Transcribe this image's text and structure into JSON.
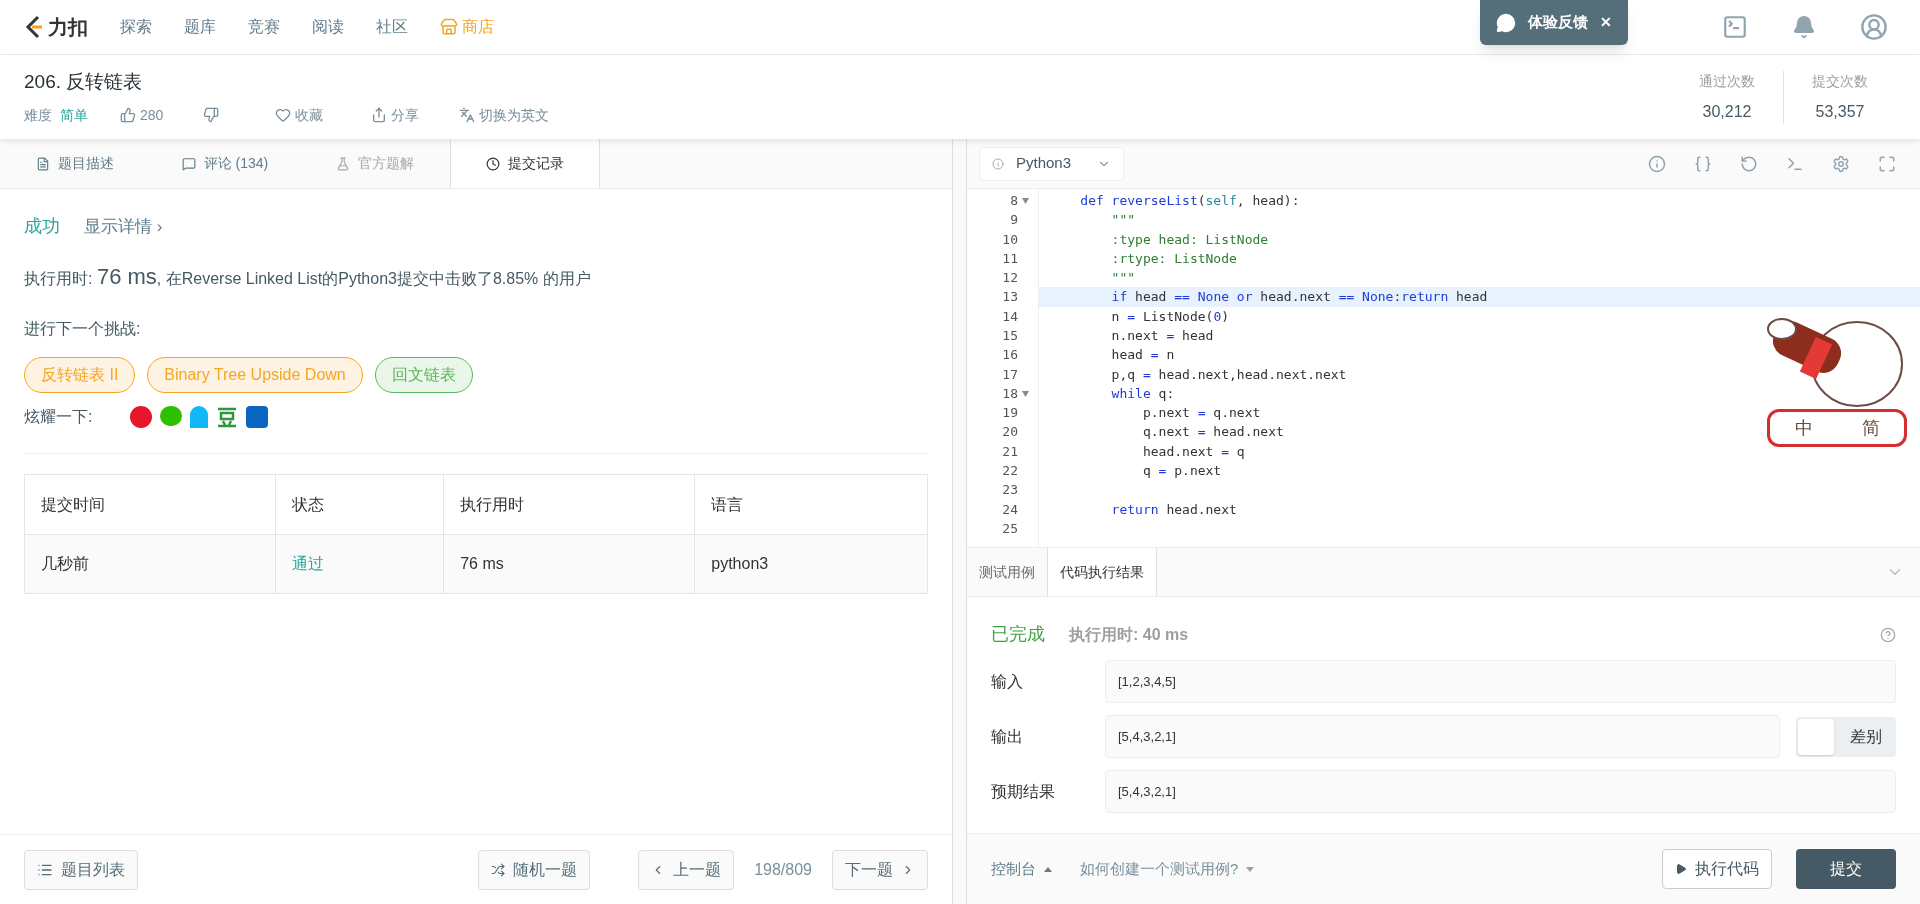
{
  "nav": {
    "logo": "力扣",
    "items": [
      {
        "label": "探索",
        "kind": "link"
      },
      {
        "label": "题库",
        "kind": "link"
      },
      {
        "label": "竞赛",
        "kind": "link"
      },
      {
        "label": "阅读",
        "kind": "link"
      },
      {
        "label": "社区",
        "kind": "link"
      },
      {
        "label": "商店",
        "kind": "store"
      }
    ]
  },
  "toast": {
    "label": "体验反馈",
    "close": "✕"
  },
  "problem": {
    "title": "206. 反转链表",
    "difficulty_label": "难度",
    "difficulty": "简单",
    "likes": "280",
    "favorite": "收藏",
    "share": "分享",
    "translate": "切换为英文"
  },
  "stats": [
    {
      "label": "通过次数",
      "value": "30,212"
    },
    {
      "label": "提交次数",
      "value": "53,357"
    }
  ],
  "tabs": [
    {
      "label": "题目描述",
      "selected": false,
      "disabled": false
    },
    {
      "label": "评论 (134)",
      "selected": false,
      "disabled": false
    },
    {
      "label": "官方题解",
      "selected": false,
      "disabled": true
    },
    {
      "label": "提交记录",
      "selected": true,
      "disabled": false
    }
  ],
  "result": {
    "status": "成功",
    "details": "显示详情 ›",
    "runtime_label": "执行用时: ",
    "runtime": "76 ms",
    "runtime_rest": ", 在Reverse Linked List的Python3提交中击败了8.85% 的用户",
    "next_label": "进行下一个挑战:",
    "challenges": [
      {
        "label": "反转链表 II",
        "color": "#f5a623"
      },
      {
        "label": "Binary Tree Upside Down",
        "color": "#f5a623"
      },
      {
        "label": "回文链表",
        "color": "#5cb85c"
      }
    ],
    "share_label": "炫耀一下:"
  },
  "submissions": {
    "columns": [
      "提交时间",
      "状态",
      "执行用时",
      "语言"
    ],
    "rows": [
      {
        "time": "几秒前",
        "status": "通过",
        "runtime": "76 ms",
        "language": "python3"
      }
    ]
  },
  "editor": {
    "language": "Python3",
    "lines": [
      {
        "number": "8",
        "foldable": true,
        "active": false,
        "tokens": [
          {
            "text": "    def reverseList",
            "kind": "keyword"
          },
          {
            "text": "(",
            "kind": "plain"
          },
          {
            "text": "self",
            "kind": "self"
          },
          {
            "text": ", head):",
            "kind": "plain"
          }
        ]
      },
      {
        "number": "9",
        "foldable": false,
        "active": false,
        "tokens": [
          {
            "text": "        \"\"\"",
            "kind": "docstring"
          }
        ]
      },
      {
        "number": "10",
        "foldable": false,
        "active": false,
        "tokens": [
          {
            "text": "        :type head: ListNode",
            "kind": "docstring"
          }
        ]
      },
      {
        "number": "11",
        "foldable": false,
        "active": false,
        "tokens": [
          {
            "text": "        :rtype: ListNode",
            "kind": "docstring"
          }
        ]
      },
      {
        "number": "12",
        "foldable": false,
        "active": false,
        "tokens": [
          {
            "text": "        \"\"\"",
            "kind": "docstring"
          }
        ]
      },
      {
        "number": "13",
        "foldable": false,
        "active": true,
        "tokens": [
          {
            "text": "        if",
            "kind": "keyword"
          },
          {
            "text": " head ",
            "kind": "plain"
          },
          {
            "text": "== None or",
            "kind": "keyword"
          },
          {
            "text": " head.next ",
            "kind": "plain"
          },
          {
            "text": "== None",
            "kind": "keyword"
          },
          {
            "text": ":",
            "kind": "plain"
          },
          {
            "text": "return",
            "kind": "keyword"
          },
          {
            "text": " head",
            "kind": "plain"
          }
        ]
      },
      {
        "number": "14",
        "foldable": false,
        "active": false,
        "tokens": [
          {
            "text": "        n ",
            "kind": "plain"
          },
          {
            "text": "=",
            "kind": "keyword"
          },
          {
            "text": " ListNode(",
            "kind": "plain"
          },
          {
            "text": "0",
            "kind": "number"
          },
          {
            "text": ")",
            "kind": "plain"
          }
        ]
      },
      {
        "number": "15",
        "foldable": false,
        "active": false,
        "tokens": [
          {
            "text": "        n.next ",
            "kind": "plain"
          },
          {
            "text": "=",
            "kind": "keyword"
          },
          {
            "text": " head",
            "kind": "plain"
          }
        ]
      },
      {
        "number": "16",
        "foldable": false,
        "active": false,
        "tokens": [
          {
            "text": "        head ",
            "kind": "plain"
          },
          {
            "text": "=",
            "kind": "keyword"
          },
          {
            "text": " n",
            "kind": "plain"
          }
        ]
      },
      {
        "number": "17",
        "foldable": false,
        "active": false,
        "tokens": [
          {
            "text": "        p,q ",
            "kind": "plain"
          },
          {
            "text": "=",
            "kind": "keyword"
          },
          {
            "text": " head.next,head.next.next",
            "kind": "plain"
          }
        ]
      },
      {
        "number": "18",
        "foldable": true,
        "active": false,
        "tokens": [
          {
            "text": "        while",
            "kind": "keyword"
          },
          {
            "text": " q:",
            "kind": "plain"
          }
        ]
      },
      {
        "number": "19",
        "foldable": false,
        "active": false,
        "tokens": [
          {
            "text": "            p.next ",
            "kind": "plain"
          },
          {
            "text": "=",
            "kind": "keyword"
          },
          {
            "text": " q.next",
            "kind": "plain"
          }
        ]
      },
      {
        "number": "20",
        "foldable": false,
        "active": false,
        "tokens": [
          {
            "text": "            q.next ",
            "kind": "plain"
          },
          {
            "text": "=",
            "kind": "keyword"
          },
          {
            "text": " head.next",
            "kind": "plain"
          }
        ]
      },
      {
        "number": "21",
        "foldable": false,
        "active": false,
        "tokens": [
          {
            "text": "            head.next ",
            "kind": "plain"
          },
          {
            "text": "=",
            "kind": "keyword"
          },
          {
            "text": " q",
            "kind": "plain"
          }
        ]
      },
      {
        "number": "22",
        "foldable": false,
        "active": false,
        "tokens": [
          {
            "text": "            q ",
            "kind": "plain"
          },
          {
            "text": "=",
            "kind": "keyword"
          },
          {
            "text": " p.next",
            "kind": "plain"
          }
        ]
      },
      {
        "number": "23",
        "foldable": false,
        "active": false
      },
      {
        "number": "24",
        "foldable": false,
        "active": false,
        "tokens": [
          {
            "text": "        return",
            "kind": "keyword"
          },
          {
            "text": " head.next",
            "kind": "plain"
          }
        ]
      },
      {
        "number": "25",
        "foldable": false,
        "active": false
      }
    ]
  },
  "ime_toolbar": [
    "中",
    "简"
  ],
  "console_tabs": [
    {
      "label": "测试用例",
      "selected": false
    },
    {
      "label": "代码执行结果",
      "selected": true
    }
  ],
  "run_result": {
    "status": "已完成",
    "runtime": "执行用时: 40 ms",
    "fields": [
      {
        "label": "输入",
        "value": "[1,2,3,4,5]"
      },
      {
        "label": "输出",
        "value": "[5,4,3,2,1]",
        "diff": {
          "label": "差别",
          "on": false
        }
      },
      {
        "label": "预期结果",
        "value": "[5,4,3,2,1]"
      }
    ]
  },
  "footer_left": {
    "list": "题目列表",
    "random": "随机一题",
    "prev": "上一题",
    "progress": "198/809",
    "next": "下一题"
  },
  "footer_right": {
    "console": "控制台",
    "howto": "如何创建一个测试用例?",
    "run": "执行代码",
    "submit": "提交"
  }
}
